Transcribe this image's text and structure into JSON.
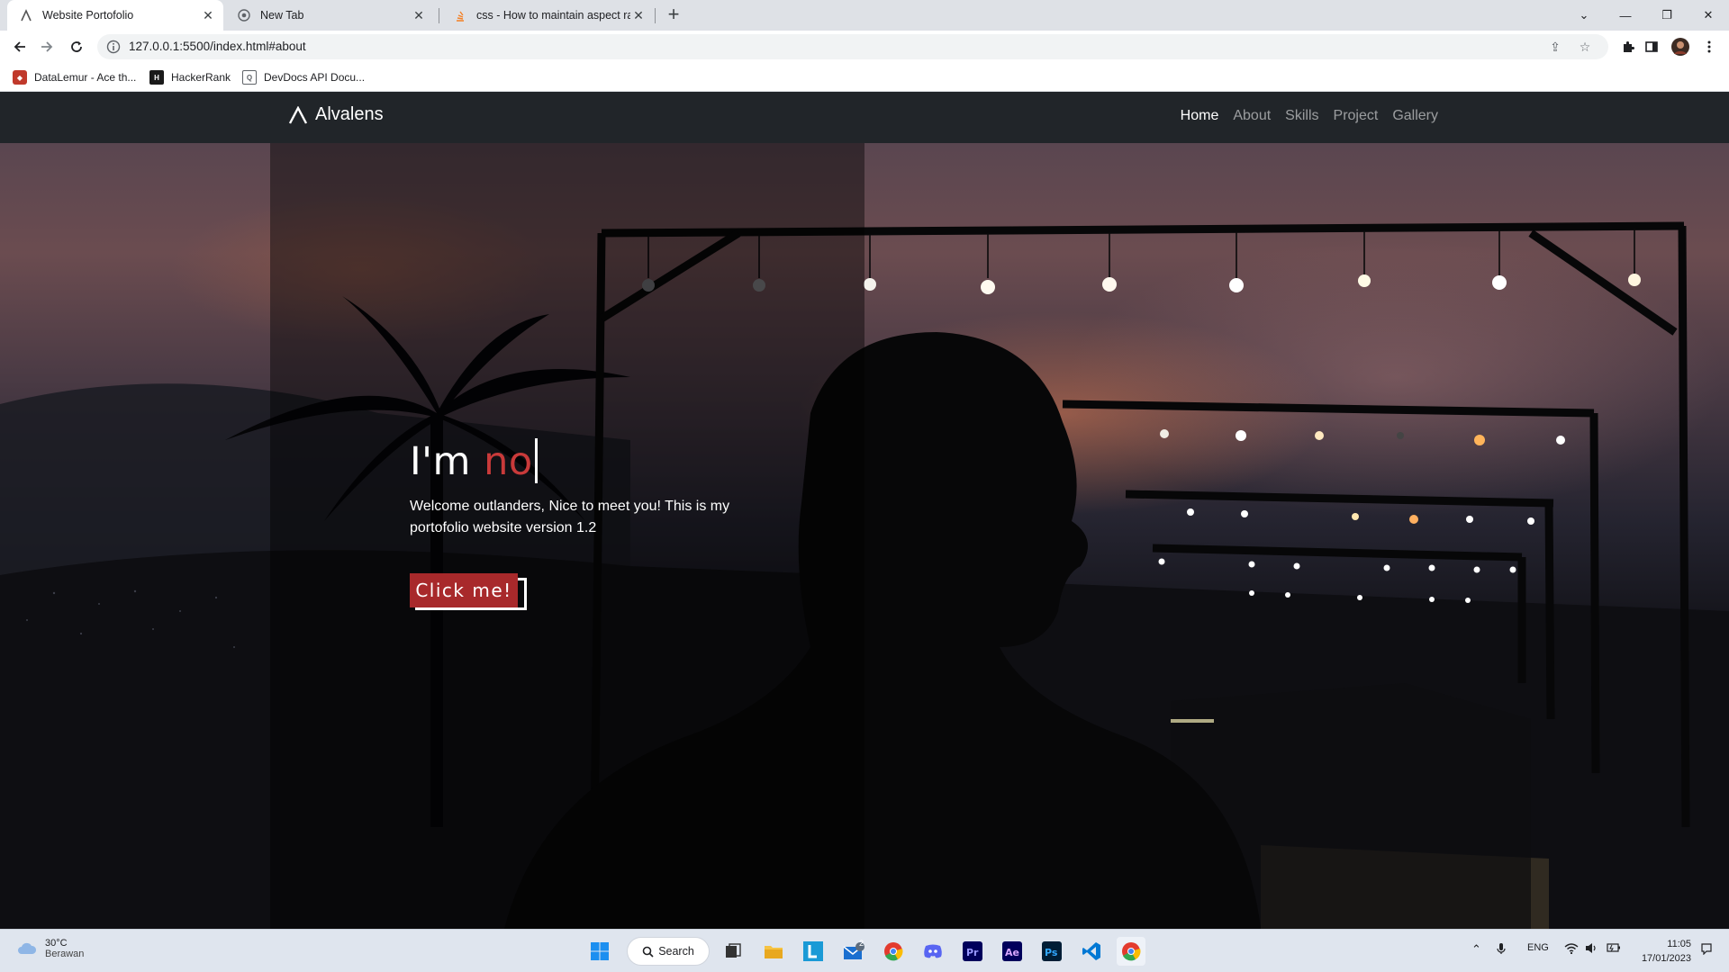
{
  "browser": {
    "tabs": [
      {
        "title": "Website Portofolio",
        "active": true
      },
      {
        "title": "New Tab",
        "active": false
      },
      {
        "title": "css - How to maintain aspect rati",
        "active": false
      }
    ],
    "url": "127.0.0.1:5500/index.html#about",
    "bookmarks": [
      {
        "label": "DataLemur - Ace th...",
        "icon": "datalemur-icon"
      },
      {
        "label": "HackerRank",
        "icon": "hackerrank-icon"
      },
      {
        "label": "DevDocs API Docu...",
        "icon": "devdocs-icon"
      }
    ]
  },
  "site": {
    "brand": "Alvalens",
    "nav": [
      "Home",
      "About",
      "Skills",
      "Project",
      "Gallery"
    ],
    "active_nav": "Home",
    "hero": {
      "title_prefix": "I'm ",
      "title_typed": "no",
      "description": "Welcome outlanders, Nice to meet you! This is my portofolio website version 1.2",
      "button": "Click me!"
    },
    "colors": {
      "accent": "#a8292b",
      "typed": "#c93a3a",
      "nav_bg": "#212529"
    }
  },
  "taskbar": {
    "weather_temp": "30°C",
    "weather_desc": "Berawan",
    "search_label": "Search",
    "mail_badge": "2",
    "language": "ENG",
    "time": "11:05",
    "date": "17/01/2023"
  }
}
